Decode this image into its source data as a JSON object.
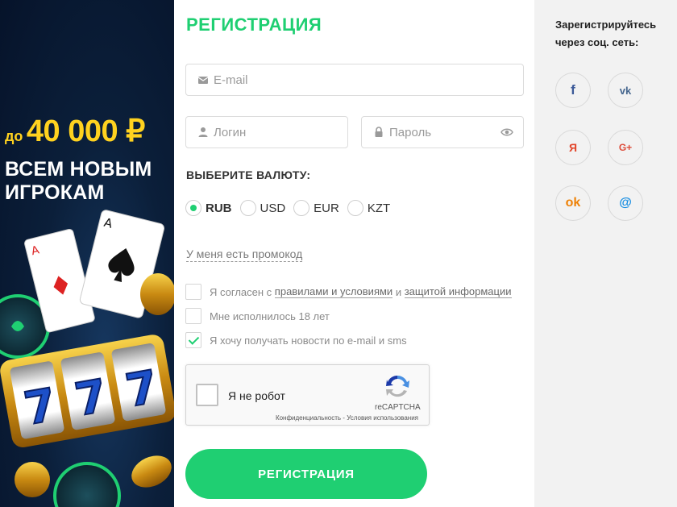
{
  "promo": {
    "bonus_prefix": "до",
    "bonus_amount": "40 000 ₽",
    "line1": "ВСЕМ НОВЫМ",
    "line2": "ИГРОКАМ"
  },
  "form": {
    "title": "РЕГИСТРАЦИЯ",
    "email_placeholder": "E-mail",
    "login_placeholder": "Логин",
    "password_placeholder": "Пароль",
    "currency_title": "ВЫБЕРИТЕ ВАЛЮТУ:",
    "currencies": [
      {
        "label": "RUB",
        "selected": true
      },
      {
        "label": "USD",
        "selected": false
      },
      {
        "label": "EUR",
        "selected": false
      },
      {
        "label": "KZT",
        "selected": false
      }
    ],
    "promo_code_link": "У меня есть промокод",
    "terms": {
      "prefix": "Я согласен с",
      "rules_link": "правилами и условиями",
      "and": "и",
      "privacy_link": "защитой информации",
      "checked": false
    },
    "age_label": "Мне исполнилось 18 лет",
    "age_checked": false,
    "news_label": "Я хочу получать новости по e-mail и sms",
    "news_checked": true,
    "captcha": {
      "label": "Я не робот",
      "brand": "reCAPTCHA",
      "terms": "Конфиденциальность - Условия использования"
    },
    "submit_label": "РЕГИСТРАЦИЯ",
    "accent_color": "#1fcf72"
  },
  "social": {
    "title": "Зарегистрируйтесь через соц. сеть:",
    "buttons": [
      {
        "name": "facebook",
        "glyph": "f"
      },
      {
        "name": "vkontakte",
        "glyph": "vk"
      },
      {
        "name": "yandex",
        "glyph": "Я"
      },
      {
        "name": "google-plus",
        "glyph": "G+"
      },
      {
        "name": "odnoklassniki",
        "glyph": "ok"
      },
      {
        "name": "mail-ru",
        "glyph": "@"
      }
    ]
  }
}
